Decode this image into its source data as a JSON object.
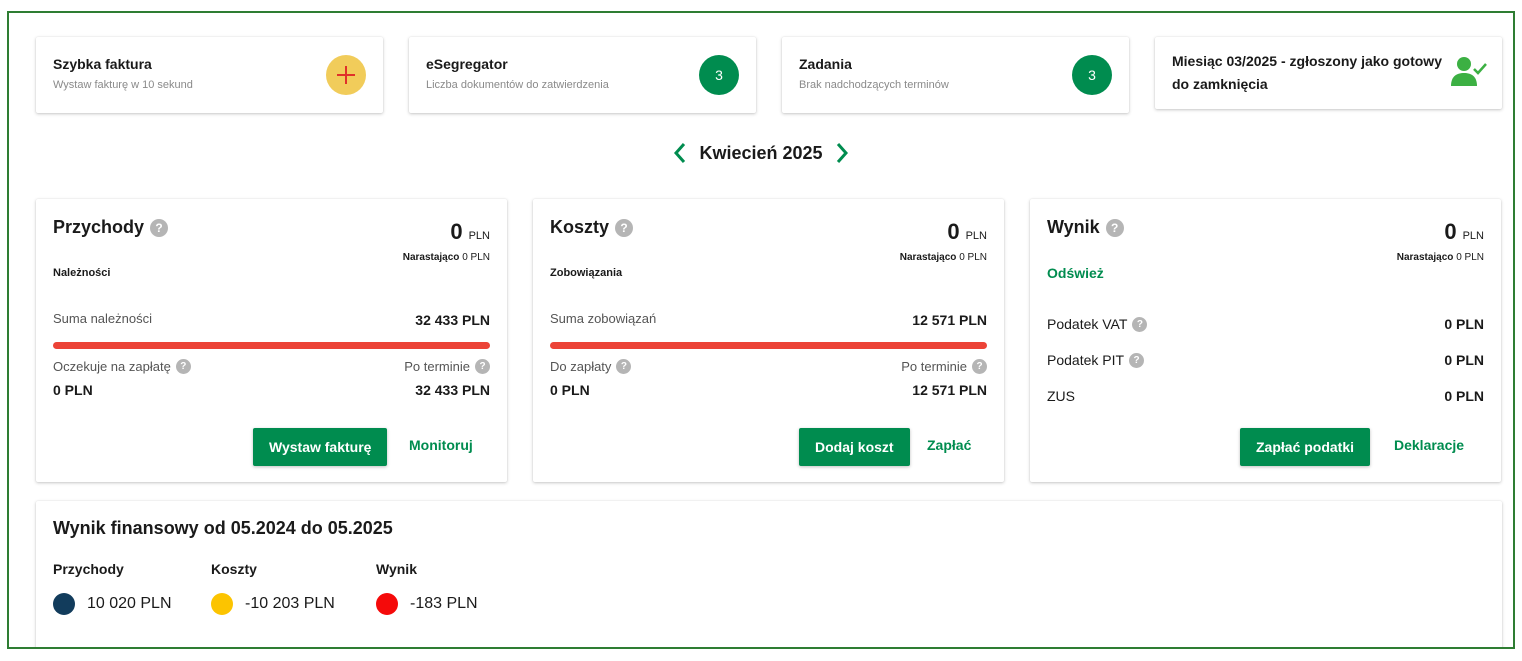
{
  "tiles": {
    "quick_invoice": {
      "title": "Szybka faktura",
      "subtitle": "Wystaw fakturę w 10 sekund",
      "icon": "plus-icon"
    },
    "esegregator": {
      "title": "eSegregator",
      "subtitle": "Liczba dokumentów do zatwierdzenia",
      "count": "3"
    },
    "tasks": {
      "title": "Zadania",
      "subtitle": "Brak nadchodzących terminów",
      "count": "3"
    },
    "month_status": {
      "title": "Miesiąc 03/2025 - zgłoszony jako gotowy do zamknięcia",
      "icon": "user-check-icon"
    }
  },
  "month_nav": {
    "label": "Kwiecień 2025",
    "prev_icon": "chevron-left-icon",
    "next_icon": "chevron-right-icon"
  },
  "revenue": {
    "title": "Przychody",
    "amount": "0",
    "currency": "PLN",
    "cumulative_label": "Narastająco",
    "cumulative_value": "0 PLN",
    "section": "Należności",
    "sum_label": "Suma należności",
    "sum_value": "32 433 PLN",
    "awaiting_label": "Oczekuje na zapłatę",
    "awaiting_value": "0 PLN",
    "overdue_label": "Po terminie",
    "overdue_value": "32 433 PLN",
    "overdue_fraction": 1.0,
    "primary_button": "Wystaw fakturę",
    "link": "Monitoruj"
  },
  "costs": {
    "title": "Koszty",
    "amount": "0",
    "currency": "PLN",
    "cumulative_label": "Narastająco",
    "cumulative_value": "0 PLN",
    "section": "Zobowiązania",
    "sum_label": "Suma zobowiązań",
    "sum_value": "12 571 PLN",
    "to_pay_label": "Do zapłaty",
    "to_pay_value": "0 PLN",
    "overdue_label": "Po terminie",
    "overdue_value": "12 571 PLN",
    "overdue_fraction": 1.0,
    "primary_button": "Dodaj koszt",
    "link": "Zapłać"
  },
  "result": {
    "title": "Wynik",
    "amount": "0",
    "currency": "PLN",
    "cumulative_label": "Narastająco",
    "cumulative_value": "0 PLN",
    "refresh": "Odśwież",
    "taxes": [
      {
        "label": "Podatek VAT",
        "value": "0 PLN",
        "help": true
      },
      {
        "label": "Podatek PIT",
        "value": "0 PLN",
        "help": true
      },
      {
        "label": "ZUS",
        "value": "0 PLN",
        "help": false
      }
    ],
    "primary_button": "Zapłać podatki",
    "link": "Deklaracje"
  },
  "financial": {
    "title": "Wynik finansowy od 05.2024 do 05.2025",
    "legend": [
      {
        "heading": "Przychody",
        "value": "10 020 PLN",
        "color": "#123c5c"
      },
      {
        "heading": "Koszty",
        "value": "-10 203 PLN",
        "color": "#fcc400"
      },
      {
        "heading": "Wynik",
        "value": "-183 PLN",
        "color": "#f50a0a"
      }
    ]
  },
  "colors": {
    "accent": "#008c4f",
    "alert_bar": "#ec4337",
    "frame": "#2e7d32"
  }
}
